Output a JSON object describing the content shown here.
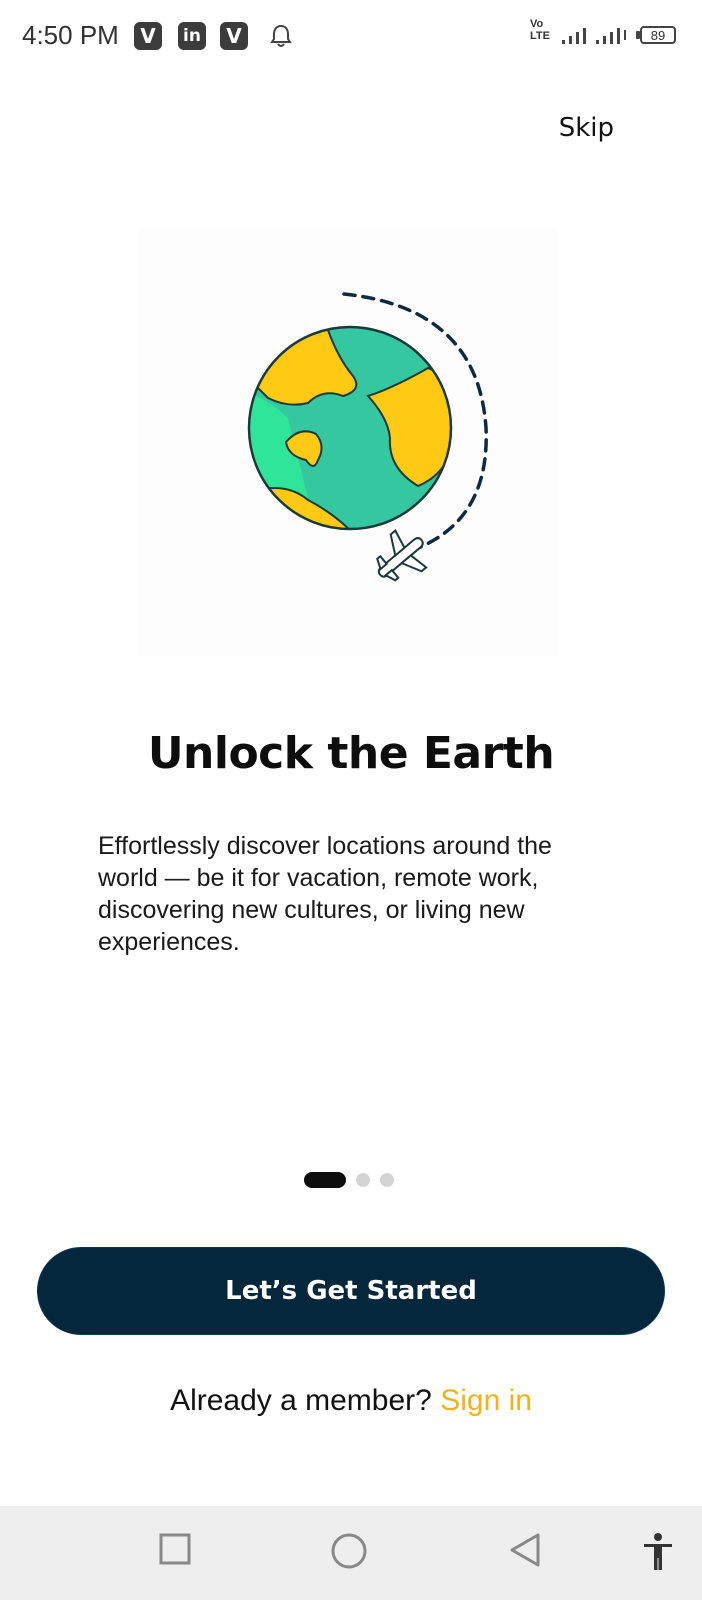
{
  "status_bar": {
    "time": "4:50 PM",
    "notifications": [
      "V",
      "in",
      "V"
    ],
    "network_label_top": "Vo",
    "network_label_bottom": "LTE",
    "battery_level": "89"
  },
  "onboarding": {
    "skip_label": "Skip",
    "title": "Unlock the Earth",
    "description": "Effortlessly discover locations around the world — be it for vacation, remote work, discovering new cultures, or living new experiences.",
    "page_index": 1,
    "page_count": 3,
    "cta_label": "Let’s Get Started",
    "member_prompt": "Already a member?",
    "signin_label": "Sign in"
  },
  "colors": {
    "primary_button": "#04273b",
    "accent_link": "#f2b21b",
    "globe_ocean": "#35c79f",
    "globe_land": "#ffc914",
    "globe_highlight": "#2ee59a"
  },
  "nav_bar": {
    "icons": [
      "recents-icon",
      "home-icon",
      "back-icon",
      "accessibility-icon"
    ]
  }
}
